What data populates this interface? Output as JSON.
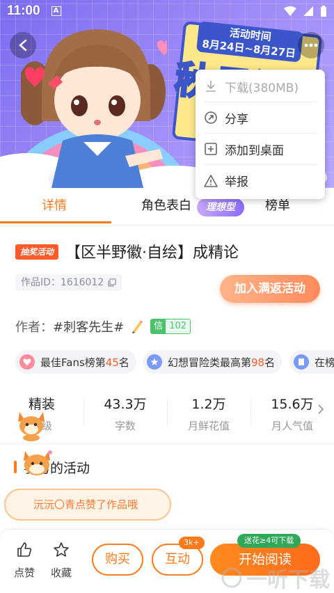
{
  "status_bar": {
    "time": "11:00",
    "notif_letter": "A"
  },
  "banner": {
    "poster_ribbon_line1": "活动时间",
    "poster_ribbon_line2": "8月24日~8月27日",
    "poster_big_text": "秋日返"
  },
  "menu": {
    "items": [
      {
        "label": "下载(380MB)",
        "icon": "download-icon",
        "disabled": true
      },
      {
        "label": "分享",
        "icon": "share-icon"
      },
      {
        "label": "添加到桌面",
        "icon": "add-to-desktop-icon"
      },
      {
        "label": "举报",
        "icon": "report-icon"
      }
    ]
  },
  "tabs": {
    "detail": "详情",
    "character": "角色表白",
    "ideal_badge": "理想型",
    "ranking": "榜单"
  },
  "work": {
    "tag": "抽奖活动",
    "title": "【区半野徽·自绘】成精论",
    "id_label": "作品ID：1616012",
    "join_button": "加入满返活动",
    "author_label": "作者：",
    "author_name": "#刺客先生#",
    "credit_key": "信",
    "credit_value": "102"
  },
  "ranks": [
    {
      "prefix": "最佳Fans榜第",
      "num": "45",
      "suffix": "名",
      "color": "#ff7a8a"
    },
    {
      "prefix": "幻想冒险类最高第",
      "num": "98",
      "suffix": "名",
      "color": "#6a8cff"
    },
    {
      "prefix": "在榜",
      "num": "",
      "suffix": "",
      "color": "#6a8cff"
    }
  ],
  "stats": [
    {
      "value": "精装",
      "label": "等级"
    },
    {
      "value": "43.3万",
      "label": "字数"
    },
    {
      "value": "1.2万",
      "label": "月鲜花值"
    },
    {
      "value": "15.6万",
      "label": "月人气值"
    }
  ],
  "section": {
    "title": "参与的活动"
  },
  "toast": {
    "text": "沅沅〇青点赞了作品哦"
  },
  "bottom": {
    "like": "点赞",
    "favorite": "收藏",
    "buy": "购买",
    "interact": "互动",
    "interact_badge": "3k+",
    "read": "开始阅读",
    "read_badge": "送花≥4可下载",
    "accent": "#ff7a1a"
  },
  "watermark": "一听下载"
}
